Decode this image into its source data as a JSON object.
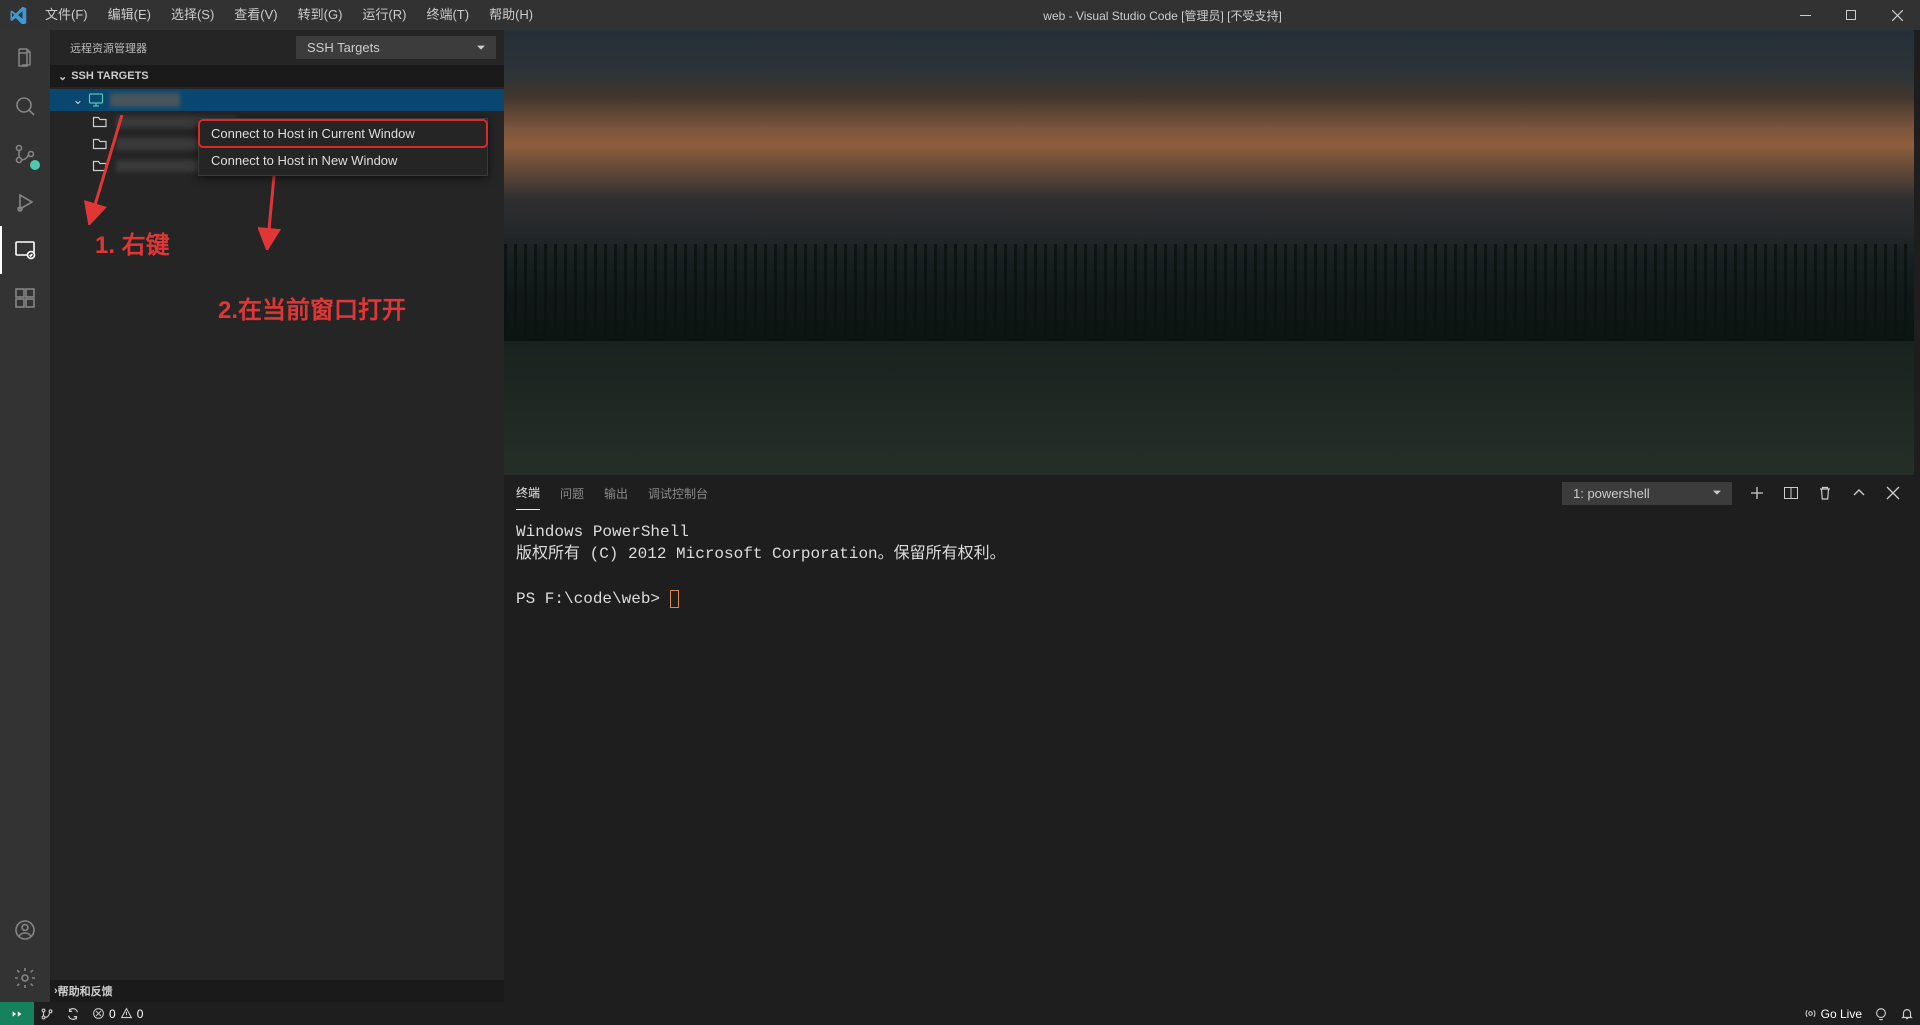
{
  "titlebar": {
    "menus": [
      "文件(F)",
      "编辑(E)",
      "选择(S)",
      "查看(V)",
      "转到(G)",
      "运行(R)",
      "终端(T)",
      "帮助(H)"
    ],
    "title": "web - Visual Studio Code [管理员] [不受支持]"
  },
  "sidebar": {
    "header_label": "远程资源管理器",
    "dropdown_value": "SSH Targets",
    "section_label": "SSH TARGETS",
    "footer_label": "帮助和反馈"
  },
  "context_menu": {
    "items": [
      "Connect to Host in Current Window",
      "Connect to Host in New Window"
    ]
  },
  "annotations": {
    "a1": "1. 右键",
    "a2": "2.在当前窗口打开"
  },
  "panel": {
    "tabs": [
      "终端",
      "问题",
      "输出",
      "调试控制台"
    ],
    "active_tab_index": 0,
    "terminal_selector": "1: powershell",
    "terminal_lines": {
      "line1": "Windows PowerShell",
      "line2": "版权所有 (C) 2012 Microsoft Corporation。保留所有权利。",
      "prompt": "PS F:\\code\\web>"
    }
  },
  "statusbar": {
    "errors": "0",
    "warnings": "0",
    "go_live": "Go Live"
  }
}
